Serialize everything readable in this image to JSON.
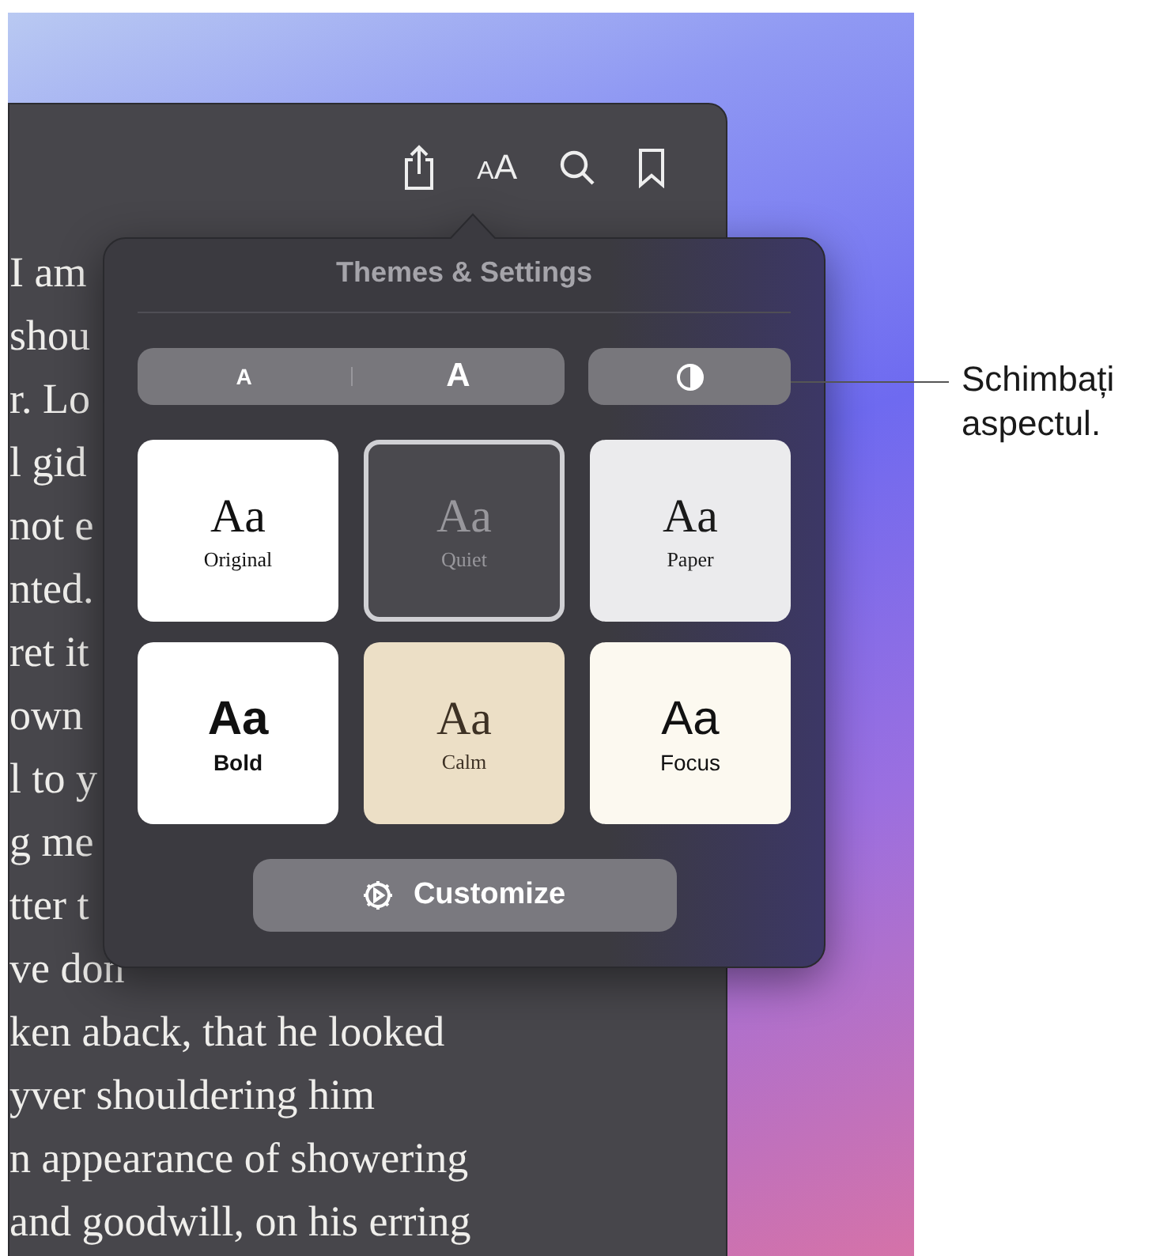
{
  "toolbar": [
    {
      "kind": "share"
    },
    {
      "kind": "text_size",
      "small": "A",
      "large": "A"
    },
    {
      "kind": "search"
    },
    {
      "kind": "bookmark"
    }
  ],
  "book_text": [
    "I am",
    "shou",
    "r. Lo",
    "l gid",
    "not e",
    "nted.",
    "ret it",
    "own",
    "l to y",
    "g me",
    "tter t",
    "ve don",
    "ken aback, that he looked",
    "yver shouldering him",
    "n appearance of showering",
    "and goodwill, on his erring"
  ],
  "popover": {
    "title": "Themes & Settings",
    "font_size": {
      "smaller": "A",
      "larger": "A"
    },
    "themes": [
      {
        "sample": "Aa",
        "name": "Original",
        "kind": "original",
        "selected": false
      },
      {
        "sample": "Aa",
        "name": "Quiet",
        "kind": "quiet",
        "selected": true
      },
      {
        "sample": "Aa",
        "name": "Paper",
        "kind": "paper",
        "selected": false
      },
      {
        "sample": "Aa",
        "name": "Bold",
        "kind": "bold",
        "selected": false
      },
      {
        "sample": "Aa",
        "name": "Calm",
        "kind": "calm",
        "selected": false
      },
      {
        "sample": "Aa",
        "name": "Focus",
        "kind": "focus",
        "selected": false
      }
    ],
    "customize": "Customize"
  },
  "callout": "Schimbați aspectul."
}
